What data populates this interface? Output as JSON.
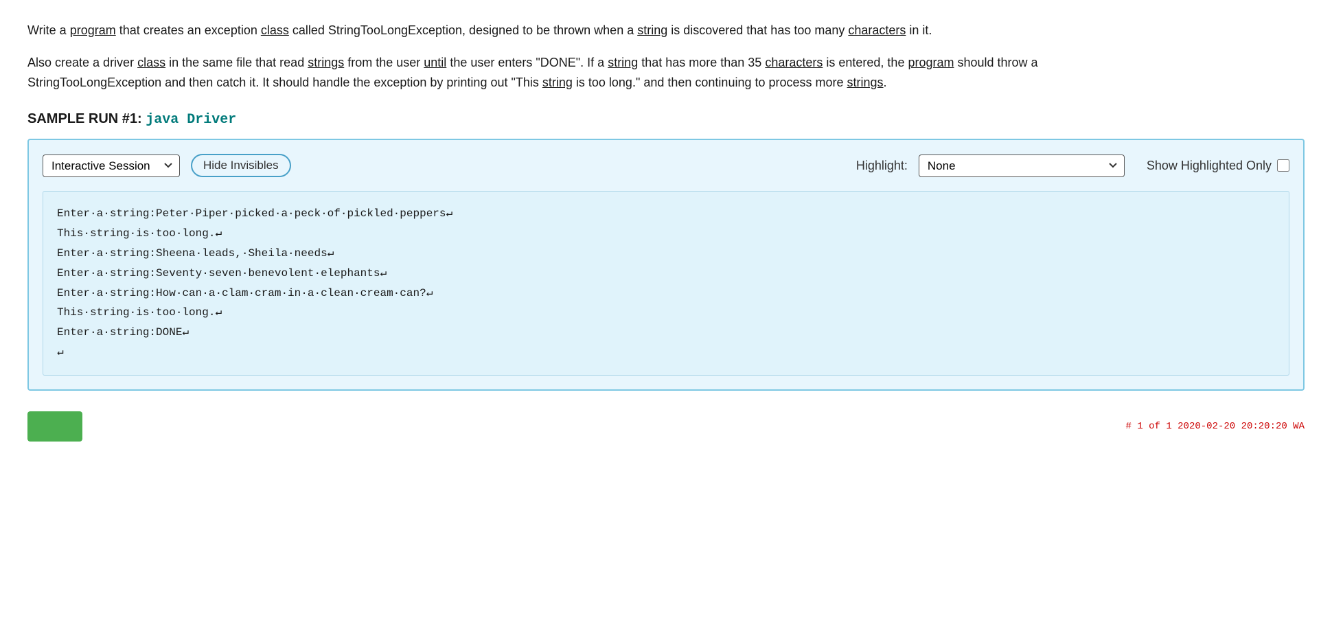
{
  "description": {
    "paragraph1": "Write a program that creates an exception class called StringTooLongException, designed to be thrown when a string is discovered that has too many characters in it.",
    "paragraph1_underline_words": [
      "program",
      "class",
      "string",
      "characters"
    ],
    "paragraph2": "Also create a driver class in the same file that read strings from the user until the user enters \"DONE\". If a string that has more than 35 characters is entered, the program should throw a StringTooLongException and then catch it. It should handle the exception by printing out \"This string is too long.\" and then continuing to process more strings.",
    "paragraph2_underline_words": [
      "class",
      "strings",
      "until",
      "string",
      "characters",
      "program",
      "string",
      "strings"
    ]
  },
  "sample_run": {
    "label": "SAMPLE RUN #1: ",
    "code": "java Driver"
  },
  "toolbar": {
    "session_type_label": "Interactive Session",
    "hide_invisibles_label": "Hide Invisibles",
    "highlight_label": "Highlight:",
    "highlight_option": "None",
    "show_highlighted_label": "Show Highlighted Only"
  },
  "session_lines": [
    "Enter·a·string:Peter·Piper·picked·a·peck·of·pickled·peppers↵",
    "This·string·is·too·long.↵",
    "Enter·a·string:Sheena·leads,·Sheila·needs↵",
    "Enter·a·string:Seventy·seven·benevolent·elephants↵",
    "Enter·a·string:How·can·a·clam·cram·in·a·clean·cream·can?↵",
    "This·string·is·too·long.↵",
    "Enter·a·string:DONE↵",
    "↵"
  ],
  "bottom": {
    "green_button_label": "",
    "bottom_right_text": "# 1 of 1  2020-02-20 20:20:20  WA"
  }
}
